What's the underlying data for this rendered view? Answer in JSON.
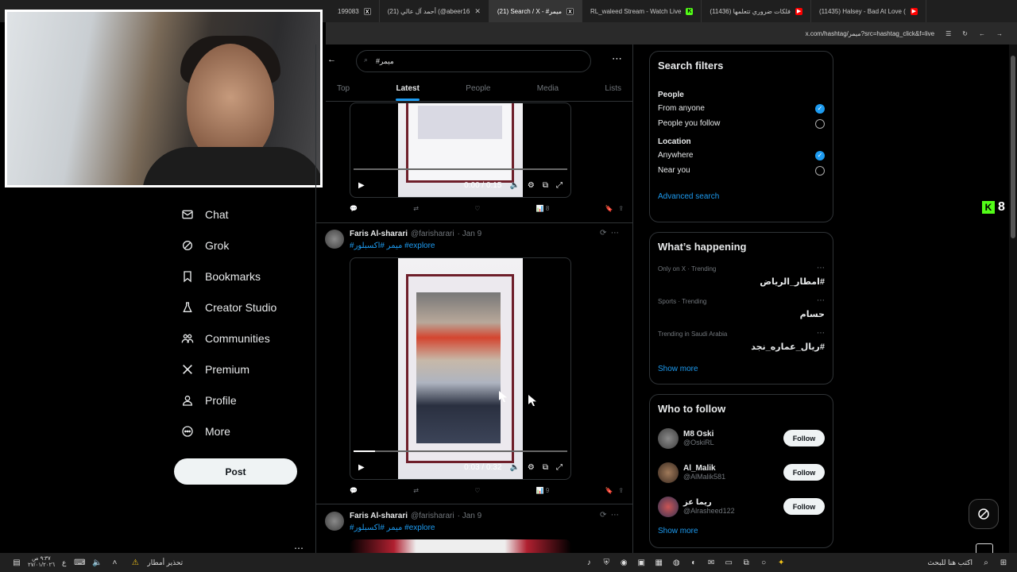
{
  "browser": {
    "tabs": [
      {
        "title": "(21) أحمد آل عالي (@abeer16",
        "favicon": "X",
        "close": "✕",
        "active": false
      },
      {
        "title": "(21) Search / X - #ميمر",
        "favicon": "X",
        "close": "✕",
        "active": true
      },
      {
        "title": "RL_waleed Stream - Watch Live",
        "favicon": "K",
        "close": "",
        "active": false
      },
      {
        "title": "(11436) فلكات ضروري تتعلمها",
        "favicon": "▶",
        "close": "✕",
        "active": false
      },
      {
        "title": "(11435) Halsey - Bad At Love (",
        "favicon": "▶",
        "close": "✕",
        "active": false
      }
    ],
    "partial_tab": "199083",
    "url": "x.com/hashtag/ميمر?src=hashtag_click&f=live"
  },
  "sidebar": {
    "items": [
      {
        "label": "Chat",
        "icon": "mail-icon"
      },
      {
        "label": "Grok",
        "icon": "grok-icon"
      },
      {
        "label": "Bookmarks",
        "icon": "bookmark-icon"
      },
      {
        "label": "Creator Studio",
        "icon": "flask-icon"
      },
      {
        "label": "Communities",
        "icon": "communities-icon"
      },
      {
        "label": "Premium",
        "icon": "x-logo-icon"
      },
      {
        "label": "Profile",
        "icon": "person-icon"
      },
      {
        "label": "More",
        "icon": "more-circle-icon"
      }
    ],
    "post_label": "Post"
  },
  "feed": {
    "search_value": "#ميمر",
    "tabs": [
      "Top",
      "Latest",
      "People",
      "Media",
      "Lists"
    ],
    "active_tab": "Latest",
    "tweets": [
      {
        "video_time": "0:00 / 0:15",
        "views": "8",
        "progress": 0.0
      },
      {
        "name": "Faris Al-sharari",
        "handle": "@farisharari",
        "date": "· Jan 9",
        "hashtags": "#ميمر #اكسبلور #explore",
        "video_time": "0:03 / 0:32",
        "views": "9",
        "progress": 0.1
      },
      {
        "name": "Faris Al-sharari",
        "handle": "@farisharari",
        "date": "· Jan 9",
        "hashtags": "#ميمر #اكسبلور #explore"
      }
    ]
  },
  "filters": {
    "title": "Search filters",
    "people_heading": "People",
    "people_options": [
      {
        "label": "From anyone",
        "checked": true
      },
      {
        "label": "People you follow",
        "checked": false
      }
    ],
    "location_heading": "Location",
    "location_options": [
      {
        "label": "Anywhere",
        "checked": true
      },
      {
        "label": "Near you",
        "checked": false
      }
    ],
    "advanced": "Advanced search"
  },
  "happening": {
    "title": "What’s happening",
    "trends": [
      {
        "meta": "Only on X · Trending",
        "name": "#امطار_الرياض"
      },
      {
        "meta": "Sports · Trending",
        "name": "حسام"
      },
      {
        "meta": "Trending in Saudi Arabia",
        "name": "#ريال_عماره_نجد"
      }
    ],
    "show_more": "Show more"
  },
  "who_to_follow": {
    "title": "Who to follow",
    "accounts": [
      {
        "name": "M8 Oski",
        "handle": "@OskiRL"
      },
      {
        "name": "Al_Malik",
        "handle": "@AlMalik581"
      },
      {
        "name": "ريما عز",
        "handle": "@Alrasheed122"
      }
    ],
    "follow_label": "Follow",
    "show_more": "Show more"
  },
  "overlay": {
    "kick_count": "8"
  },
  "taskbar": {
    "search_placeholder": "اكتب هنا للبحث",
    "weather": "تحذير أمطار",
    "time": "٩:٣٧ ص",
    "date": "٢٧/٠١/٢٠٢٦",
    "lang": "ع"
  },
  "colors": {
    "accent": "#1d9bf0",
    "background": "#000000",
    "border": "#2f3336"
  }
}
